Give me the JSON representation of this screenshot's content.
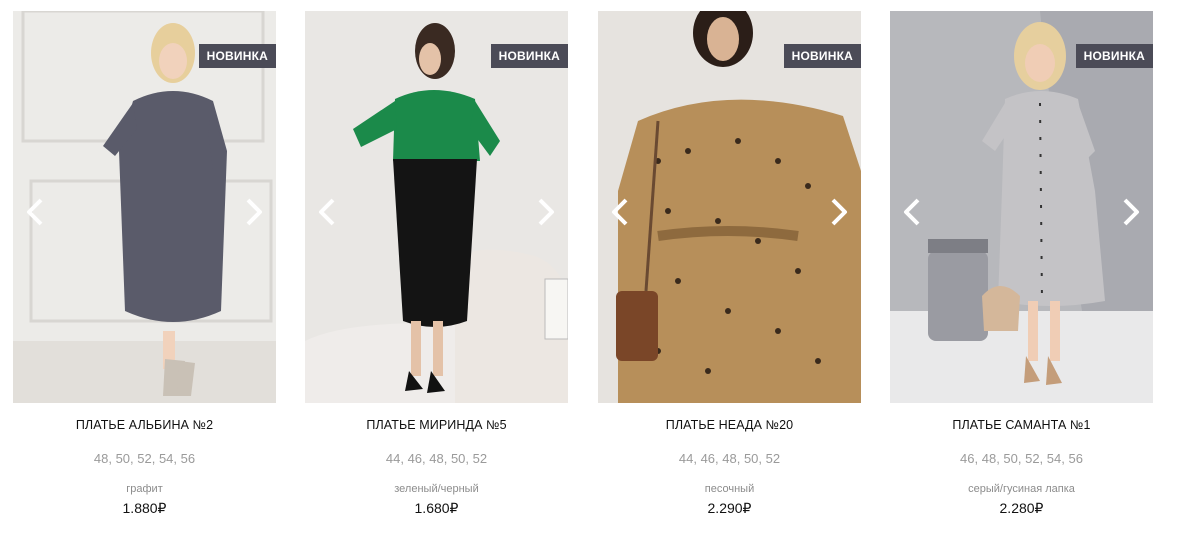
{
  "products": [
    {
      "badge": "НОВИНКА",
      "title": "ПЛАТЬЕ АЛЬБИНА №2",
      "sizes": "48, 50, 52, 54, 56",
      "color": "графит",
      "price": "1.880₽",
      "bg": "#ece9e6",
      "garment": "#5a5b6a",
      "accent": "#5a5b6a"
    },
    {
      "badge": "НОВИНКА",
      "title": "ПЛАТЬЕ МИРИНДА №5",
      "sizes": "44, 46, 48, 50, 52",
      "color": "зеленый/черный",
      "price": "1.680₽",
      "bg": "#e9e6e3",
      "garment": "#111111",
      "accent": "#1b8a4a"
    },
    {
      "badge": "НОВИНКА",
      "title": "ПЛАТЬЕ НЕАДА №20",
      "sizes": "44, 46, 48, 50, 52",
      "color": "песочный",
      "price": "2.290₽",
      "bg": "#e7e4df",
      "garment": "#b78f5a",
      "accent": "#7a5a3a"
    },
    {
      "badge": "НОВИНКА",
      "title": "ПЛАТЬЕ САМАНТА №1",
      "sizes": "46, 48, 50, 52, 54, 56",
      "color": "серый/гусиная лапка",
      "price": "2.280₽",
      "bg": "#d8d8da",
      "garment": "#c4c3c6",
      "accent": "#c9ab8c"
    }
  ]
}
